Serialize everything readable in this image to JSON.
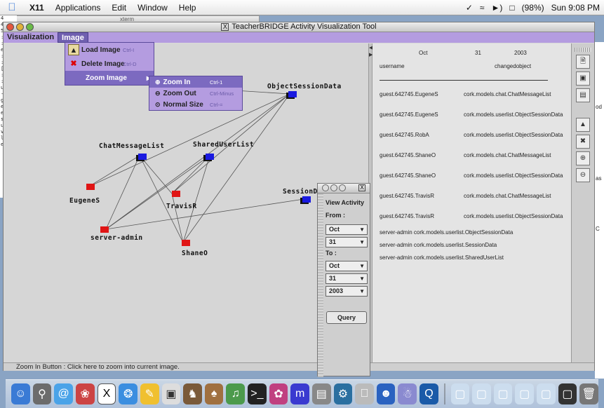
{
  "menubar": {
    "app": "X11",
    "items": [
      "Applications",
      "Edit",
      "Window",
      "Help"
    ],
    "battery": "(98%)",
    "clock": "Sun 9:08 PM"
  },
  "background": {
    "xterm_title": "xterm",
    "terminal_lines": [
      "4",
      "4",
      "5",
      ":20",
      ":!",
      "exp",
      ":20",
      ":",
      "[1]",
      ":20",
      "::",
      "use",
      "---",
      "gue",
      "ene",
      "els",
      "sag",
      "ues",
      "vis",
      "lis",
      "erv"
    ],
    "right_edge": [
      "od",
      "as",
      "C"
    ]
  },
  "window": {
    "title": "TeacherBRIDGE Activity Visualization Tool",
    "menu": [
      "Visualization",
      "Image"
    ],
    "status": "Zoom In Button : Click here to zoom into current image."
  },
  "image_menu": {
    "items": [
      {
        "label": "Load Image",
        "shortcut": "Ctrl-I"
      },
      {
        "label": "Delete Image",
        "shortcut": "Ctrl-D"
      },
      {
        "label": "Zoom Image",
        "shortcut": ""
      }
    ],
    "zoom_submenu": [
      {
        "label": "Zoom In",
        "shortcut": "Ctrl-1"
      },
      {
        "label": "Zoom Out",
        "shortcut": "Ctrl-Minus"
      },
      {
        "label": "Normal Size",
        "shortcut": "Ctrl-="
      }
    ]
  },
  "graph": {
    "nodes": {
      "object_session_data": "ObjectSessionData",
      "chat_message_list": "ChatMessageList",
      "shared_user_list": "SharedUserList",
      "session_data": "SessionData",
      "eugenes": "EugeneS",
      "travisr": "TravisR",
      "server_admin": "server-admin",
      "shaneo": "ShaneO"
    }
  },
  "activity_panel": {
    "header": {
      "month": "Oct",
      "day": "31",
      "year": "2003"
    },
    "columns": {
      "user": "username",
      "object": "changedobject"
    },
    "rows": [
      {
        "user": "guest.642745.EugeneS",
        "object": "cork.models.chat.ChatMessageList"
      },
      {
        "user": "guest.642745.EugeneS",
        "object": "cork.models.userlist.ObjectSessionData"
      },
      {
        "user": "guest.642745.RobA",
        "object": "cork.models.userlist.ObjectSessionData"
      },
      {
        "user": "guest.642745.ShaneO",
        "object": "cork.models.chat.ChatMessageList"
      },
      {
        "user": "guest.642745.ShaneO",
        "object": "cork.models.userlist.ObjectSessionData"
      },
      {
        "user": "guest.642745.TravisR",
        "object": "cork.models.chat.ChatMessageList"
      },
      {
        "user": "guest.642745.TravisR",
        "object": "cork.models.userlist.ObjectSessionData"
      }
    ],
    "admin_rows": [
      "server-admin  cork.models.userlist.ObjectSessionData",
      "server-admin  cork.models.userlist.SessionData",
      "server-admin  cork.models.userlist.SharedUserList"
    ]
  },
  "view_activity": {
    "title": "View Activity",
    "from_label": "From :",
    "to_label": "To :",
    "from": {
      "month": "Oct",
      "day": "31"
    },
    "to": {
      "month": "Oct",
      "day": "31",
      "year": "2003"
    },
    "query_label": "Query"
  }
}
